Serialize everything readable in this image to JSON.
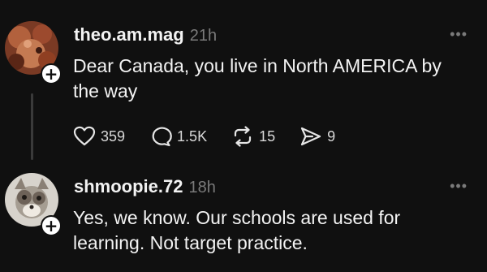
{
  "posts": [
    {
      "username": "theo.am.mag",
      "time": "21h",
      "text": "Dear Canada, you live in North AMERICA by the way",
      "more_label": "•••",
      "follow_label": "+",
      "likes": "359",
      "replies": "1.5K",
      "reposts": "15",
      "shares": "9"
    },
    {
      "username": "shmoopie.72",
      "time": "18h",
      "text": "Yes, we know. Our schools are used for learning. Not target practice.",
      "more_label": "•••",
      "follow_label": "+"
    }
  ],
  "icons": {
    "like": "heart-icon",
    "reply": "comment-bubble-icon",
    "repost": "repost-arrows-icon",
    "share": "send-arrow-icon"
  },
  "colors": {
    "background": "#101010",
    "text": "#f3f3f3",
    "muted": "#7a7a7a",
    "thread_line": "#3a3a3a"
  }
}
